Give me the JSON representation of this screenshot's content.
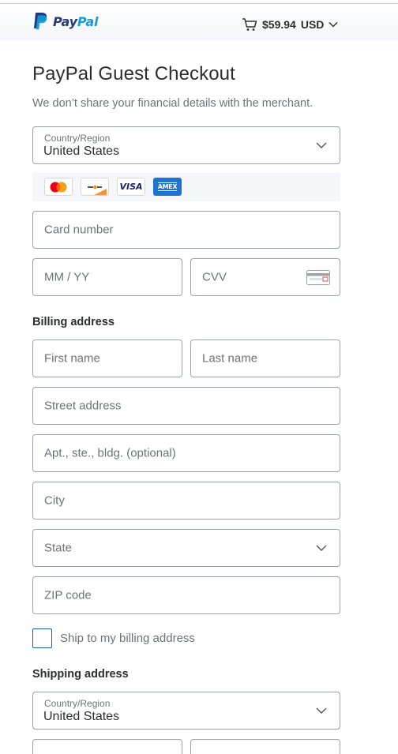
{
  "header": {
    "brand_pay": "Pay",
    "brand_pal": "Pal",
    "cart_amount": "$59.94",
    "cart_currency": "USD"
  },
  "page": {
    "title": "PayPal Guest Checkout",
    "subtitle": "We don’t share your financial details with the merchant."
  },
  "card": {
    "country_label": "Country/Region",
    "country_value": "United States",
    "accepted_cards": [
      "mastercard-icon",
      "discover-icon",
      "visa-icon",
      "amex-icon"
    ],
    "visa_text": "VISA",
    "amex_text": "AMEX",
    "card_number_placeholder": "Card number",
    "expiry_placeholder": "MM / YY",
    "cvv_placeholder": "CVV"
  },
  "billing": {
    "heading": "Billing address",
    "first_name_placeholder": "First name",
    "last_name_placeholder": "Last name",
    "street_placeholder": "Street address",
    "apt_placeholder": "Apt., ste., bldg. (optional)",
    "city_placeholder": "City",
    "state_placeholder": "State",
    "zip_placeholder": "ZIP code",
    "ship_checkbox_label": "Ship to my billing address"
  },
  "shipping": {
    "heading": "Shipping address",
    "country_label": "Country/Region",
    "country_value": "United States"
  },
  "colors": {
    "paypal_dark_blue": "#253b80",
    "paypal_light_blue": "#179bd7",
    "border": "#9da3a6",
    "placeholder": "#6c7378",
    "checkbox_border": "#1565a8"
  }
}
